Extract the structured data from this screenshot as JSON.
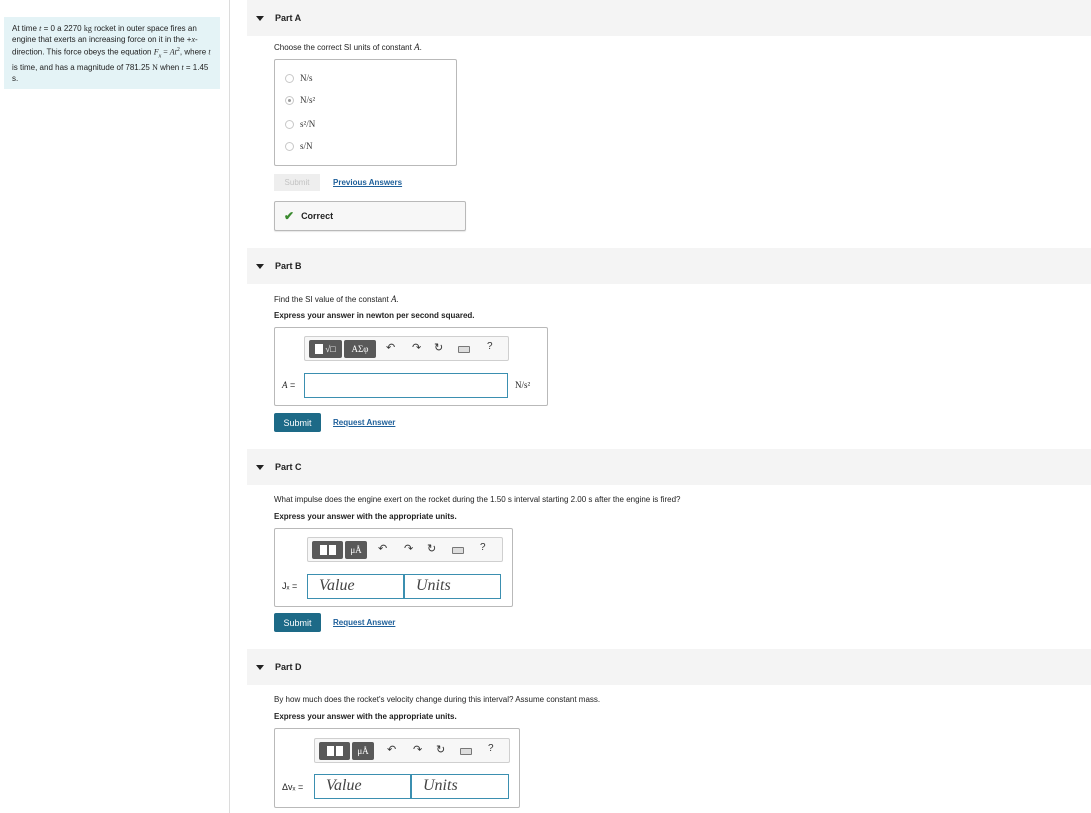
{
  "problem": {
    "text_parts": [
      "At time ",
      "t",
      " = 0 a 2270 ",
      "kg",
      " rocket in outer space fires an engine that exerts an increasing force on it in the +",
      "x",
      "-direction. This force obeys the equation ",
      "F",
      "x",
      " = ",
      "At",
      "2",
      ", where ",
      "t",
      " is time, and has a magnitude of 781.25 ",
      "N",
      " when ",
      "t",
      " = 1.45 s."
    ]
  },
  "partA": {
    "title": "Part A",
    "question_prefix": "Choose the correct SI units of constant ",
    "question_var": "A",
    "question_suffix": ".",
    "options": [
      "N/s",
      "N/s²",
      "s²/N",
      "s/N"
    ],
    "selected_index": 1,
    "submit_label": "Submit",
    "prev_answers_label": "Previous Answers",
    "feedback": "Correct"
  },
  "partB": {
    "title": "Part B",
    "question_prefix": "Find the SI value of the constant ",
    "question_var": "A",
    "question_suffix": ".",
    "instruction": "Express your answer in newton per second squared.",
    "var_label": "A =",
    "unit": "N/s²",
    "toolbar_symbol_label": "ΑΣφ",
    "help_label": "?",
    "submit_label": "Submit",
    "request_label": "Request Answer"
  },
  "partC": {
    "title": "Part C",
    "question": "What impulse does the engine exert on the rocket during the 1.50 s interval starting 2.00 s after the engine is fired?",
    "instruction": "Express your answer with the appropriate units.",
    "var_label": "Jₓ =",
    "value_placeholder": "Value",
    "units_placeholder": "Units",
    "toolbar_units_label": "μÅ",
    "help_label": "?",
    "submit_label": "Submit",
    "request_label": "Request Answer"
  },
  "partD": {
    "title": "Part D",
    "question": "By how much does the rocket's velocity change during this interval? Assume constant mass.",
    "instruction": "Express your answer with the appropriate units.",
    "var_label": "Δvₓ =",
    "value_placeholder": "Value",
    "units_placeholder": "Units",
    "toolbar_units_label": "μÅ",
    "help_label": "?"
  },
  "colors": {
    "problem_bg": "#e4f3f6",
    "submit_bg": "#1d6a87",
    "link": "#1d5f9a",
    "correct_check": "#3a8a2f",
    "field_border": "#3b8fb0"
  },
  "icons": [
    "caret-down-icon",
    "check-icon",
    "undo-icon",
    "redo-icon",
    "reset-icon",
    "keyboard-icon",
    "help-icon",
    "template-grid-icon"
  ]
}
